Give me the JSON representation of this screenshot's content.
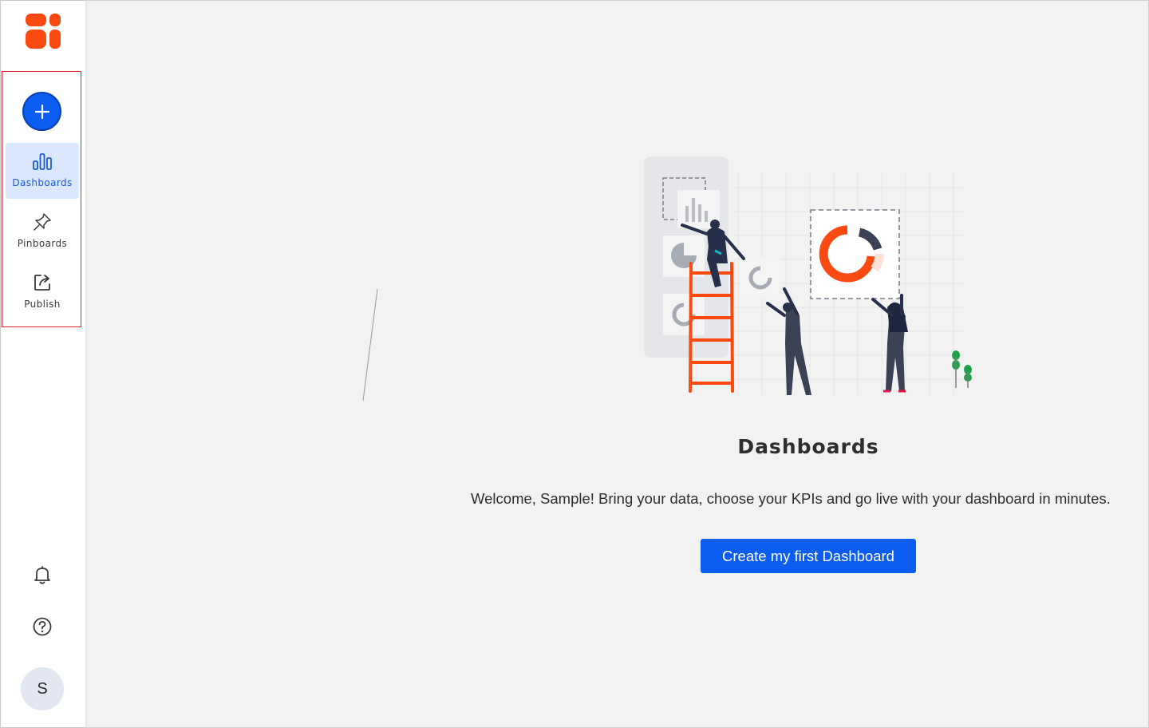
{
  "sidebar": {
    "new_button_label": "+",
    "items": [
      {
        "label": "Dashboards",
        "icon": "bar-chart-icon",
        "active": true
      },
      {
        "label": "Pinboards",
        "icon": "pin-icon",
        "active": false
      },
      {
        "label": "Publish",
        "icon": "share-icon",
        "active": false
      }
    ],
    "avatar_initial": "S"
  },
  "main": {
    "title": "Dashboards",
    "welcome_text": "Welcome, Sample! Bring your data, choose your KPIs and go live with your dashboard in minutes.",
    "cta_label": "Create my first Dashboard"
  },
  "colors": {
    "accent": "#0b5cf0",
    "brand": "#fa4a12",
    "active_bg": "#dbe7fd",
    "highlight_border": "#e0202c"
  }
}
